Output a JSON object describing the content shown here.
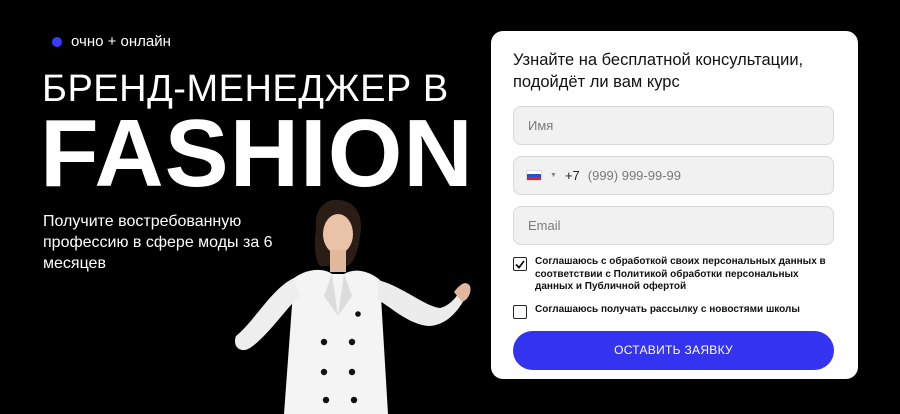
{
  "hero": {
    "badge": "очно + онлайн",
    "title_line1": "БРЕНД-МЕНЕДЖЕР В",
    "title_line2": "FASHION",
    "subtitle": "Получите востребованную профессию в сфере моды за 6 месяцев"
  },
  "form": {
    "title": "Узнайте на бесплатной консультации, подойдёт ли вам курс",
    "name_placeholder": "Имя",
    "phone_prefix": "+7",
    "phone_placeholder": "(999) 999-99-99",
    "email_placeholder": "Email",
    "consent_text": "Соглашаюсь с обработкой своих персональных данных в соответствии с Политикой обработки персональных данных и Публичной офертой",
    "consent_checked": true,
    "newsletter_text": "Соглашаюсь получать рассылку с новостями школы",
    "newsletter_checked": false,
    "submit_label": "ОСТАВИТЬ ЗАЯВКУ"
  },
  "colors": {
    "accent": "#3433f0",
    "background": "#000000",
    "card": "#ffffff"
  },
  "icons": {
    "badge": "dot-icon",
    "phone_country": "russia-flag-icon"
  }
}
